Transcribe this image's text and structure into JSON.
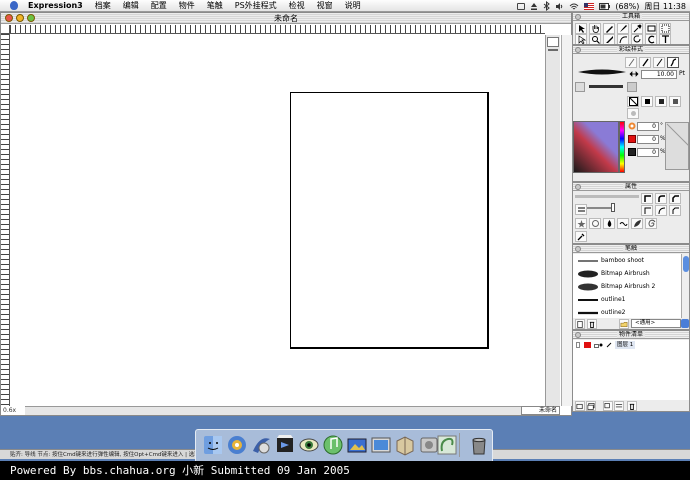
{
  "menubar": {
    "app_name": "Expression3",
    "items": [
      "档案",
      "编辑",
      "配置",
      "物件",
      "笔触",
      "PS外挂程式",
      "检视",
      "视窗",
      "说明"
    ],
    "battery": "(68%)",
    "clock": "周日 11:38"
  },
  "document": {
    "title": "未命名",
    "zoom": "0.6x",
    "coord_label": "未命名"
  },
  "toolbox": {
    "title": "工具箱"
  },
  "stroke_style": {
    "title": "彩绘样式",
    "width_value": "10.00",
    "width_unit": "Pt",
    "color_values": [
      "0",
      "0",
      "0"
    ],
    "units": [
      "°",
      "%",
      "%"
    ]
  },
  "attributes": {
    "title": "属性"
  },
  "strokes": {
    "title": "笔触",
    "items": [
      "bamboo shoot",
      "Bitmap Airbrush",
      "Bitmap Airbrush 2",
      "outline1",
      "outline2"
    ],
    "category": "<通用>"
  },
  "object_list": {
    "title": "物件清单",
    "layer_name": "图层 1"
  },
  "statusbar": {
    "text": "贴齐: 导线   节点: 按住Cmd键来进行弹性编辑, 按住Opt+Cmd键来进入 | 选取"
  },
  "footer": {
    "text": "Powered By bbs.chahua.org 小新 Submitted 09 Jan 2005"
  },
  "colors": {
    "desktop": "#5b7fb5",
    "accent_blue": "#3a66c6",
    "swatch_red": "#e01010"
  }
}
